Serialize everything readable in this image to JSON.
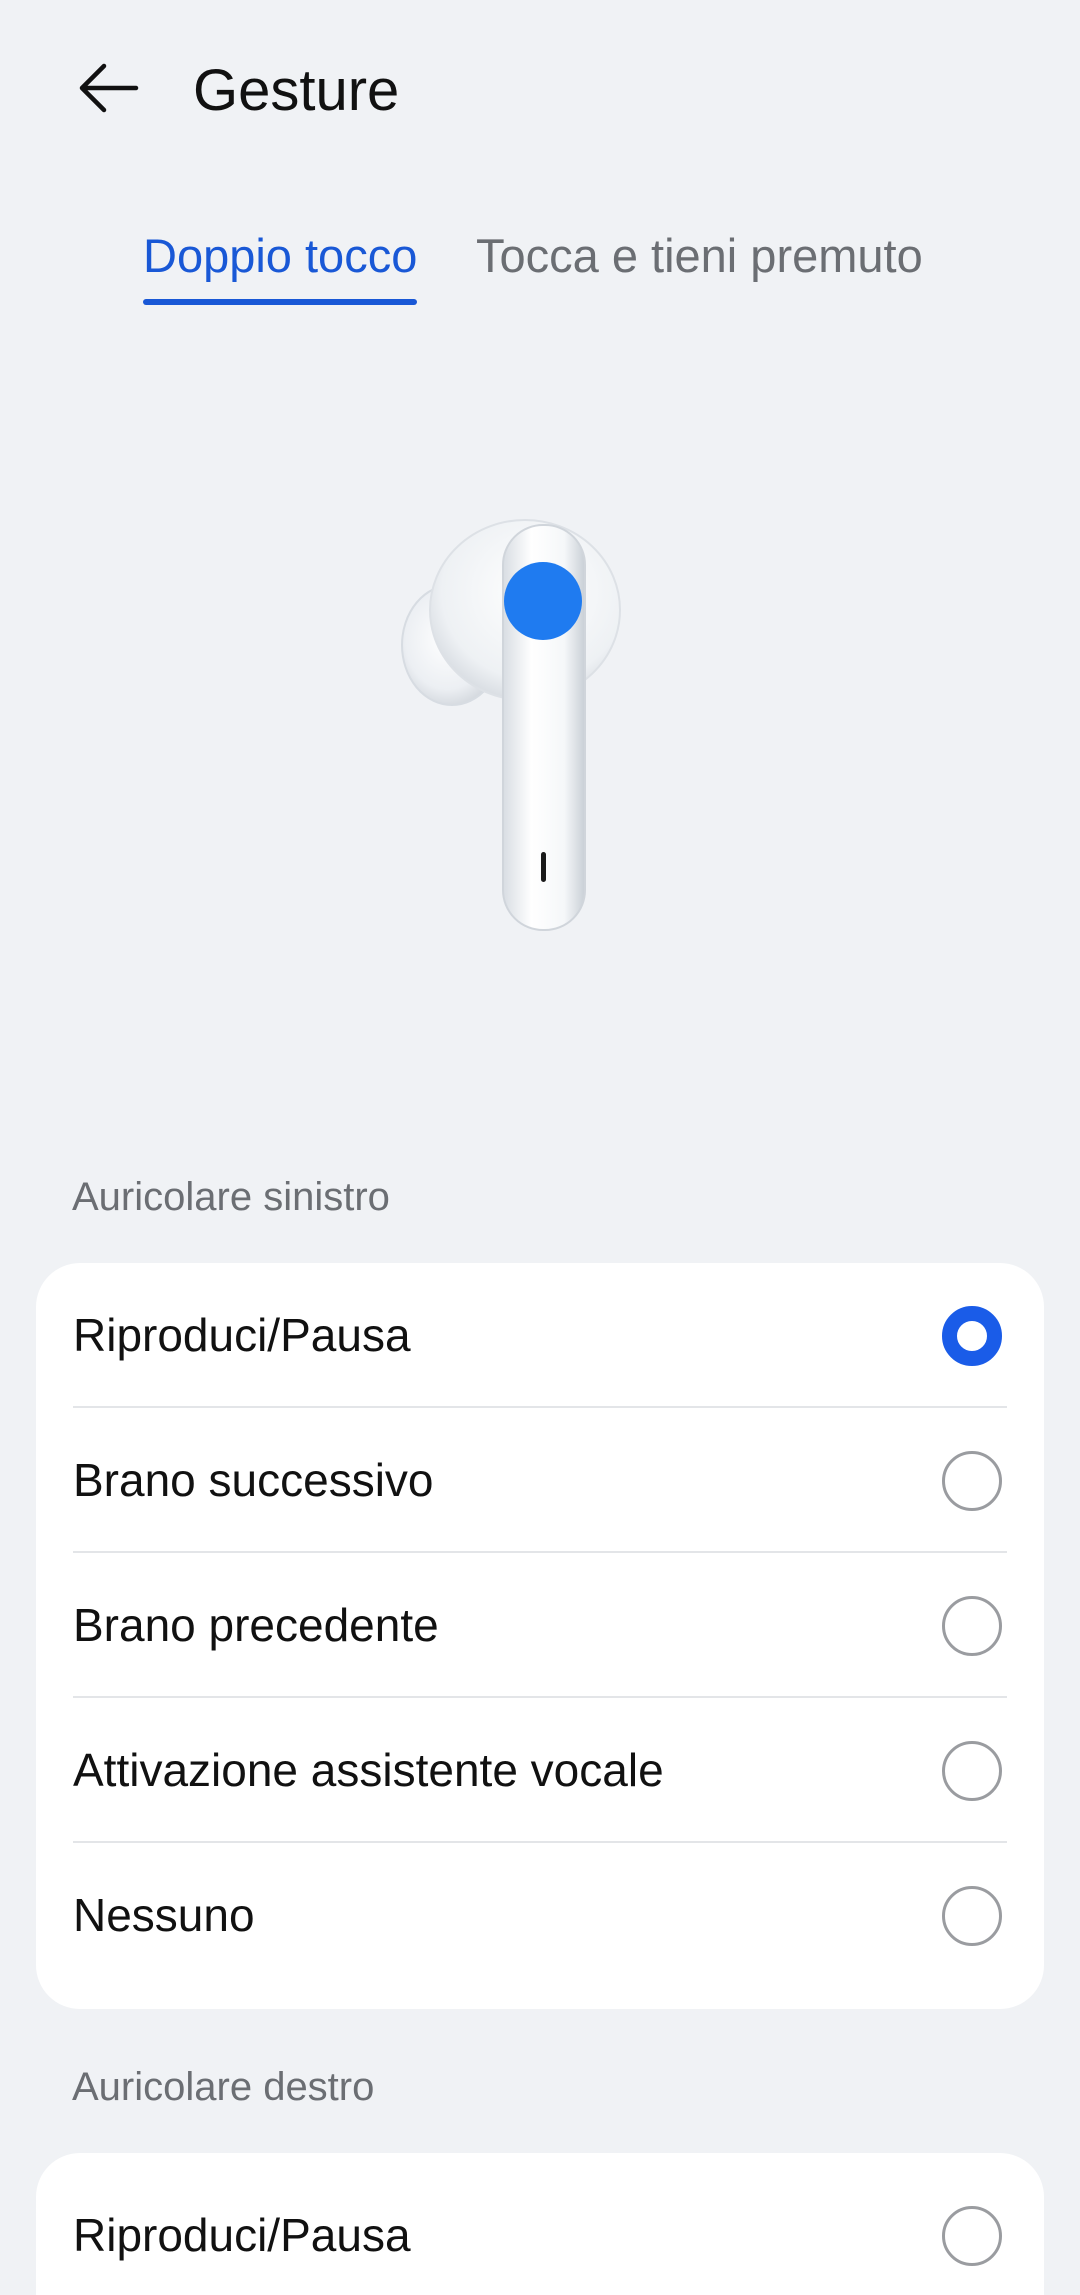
{
  "header": {
    "title": "Gesture",
    "back_icon": "arrow-left-icon"
  },
  "tabs": [
    {
      "label": "Doppio tocco",
      "active": true
    },
    {
      "label": "Tocca e tieni premuto",
      "active": false
    }
  ],
  "illustration": {
    "name": "earbud-image",
    "tap_point_color": "#1f7bf0"
  },
  "left_earbud": {
    "section_label": "Auricolare sinistro",
    "options": [
      {
        "label": "Riproduci/Pausa",
        "selected": true
      },
      {
        "label": "Brano successivo",
        "selected": false
      },
      {
        "label": "Brano precedente",
        "selected": false
      },
      {
        "label": "Attivazione assistente vocale",
        "selected": false
      },
      {
        "label": "Nessuno",
        "selected": false
      }
    ]
  },
  "right_earbud": {
    "section_label": "Auricolare destro",
    "options": [
      {
        "label": "Riproduci/Pausa",
        "selected": false
      }
    ]
  },
  "colors": {
    "accent": "#1958d6",
    "radio_checked": "#1a5ce8",
    "background": "#f0f2f5"
  }
}
